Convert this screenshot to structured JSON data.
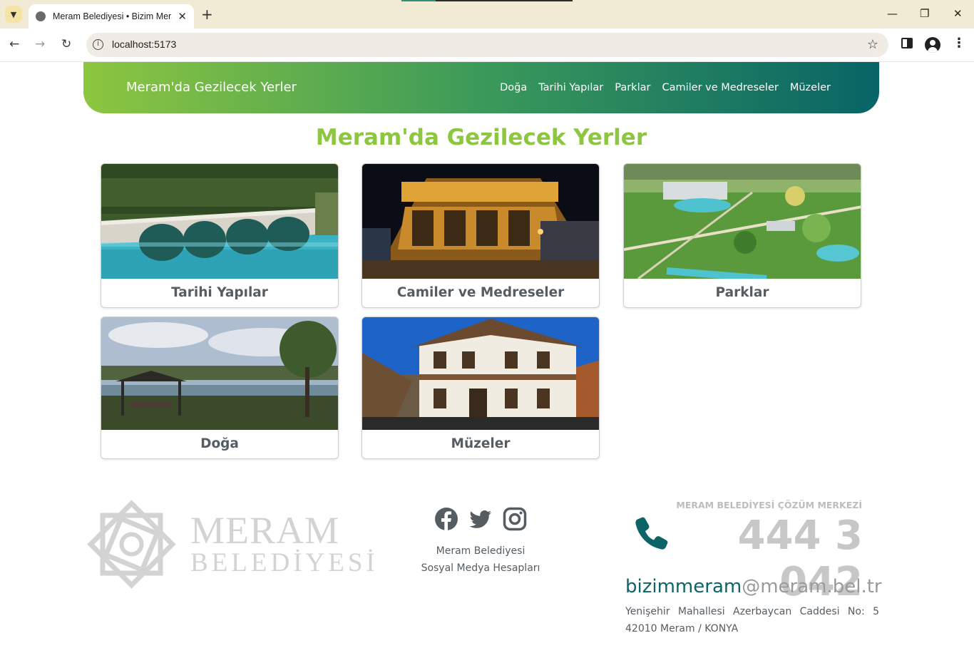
{
  "browser": {
    "tab_title": "Meram Belediyesi • Bizim Meram",
    "url": "localhost:5173"
  },
  "navbar": {
    "brand": "Meram'da Gezilecek Yerler",
    "links": [
      "Doğa",
      "Tarihi Yapılar",
      "Parklar",
      "Camiler ve Medreseler",
      "Müzeler"
    ]
  },
  "main": {
    "heading": "Meram'da Gezilecek Yerler",
    "cards": [
      {
        "label": "Tarihi Yapılar"
      },
      {
        "label": "Camiler ve Medreseler"
      },
      {
        "label": "Parklar"
      },
      {
        "label": "Doğa"
      },
      {
        "label": "Müzeler"
      }
    ]
  },
  "footer": {
    "logo_line1": "MERAM",
    "logo_line2": "BELEDİYESİ",
    "social_caption_line1": "Meram Belediyesi",
    "social_caption_line2": "Sosyal Medya Hesapları",
    "social_icons": [
      "facebook-icon",
      "twitter-icon",
      "instagram-icon"
    ],
    "call_center_title": "MERAM BELEDİYESİ ÇÖZÜM MERKEZİ",
    "phone": "444 3 042",
    "email_user": "bizimmeram",
    "email_domain": "@meram.bel.tr",
    "address_line1": "Yenişehir Mahallesi Azerbaycan Caddesi No: 5",
    "address_line2": "42010 Meram / KONYA"
  },
  "colors": {
    "brand_green": "#8dc63f",
    "brand_teal": "#086466",
    "muted_text": "#555c62"
  }
}
